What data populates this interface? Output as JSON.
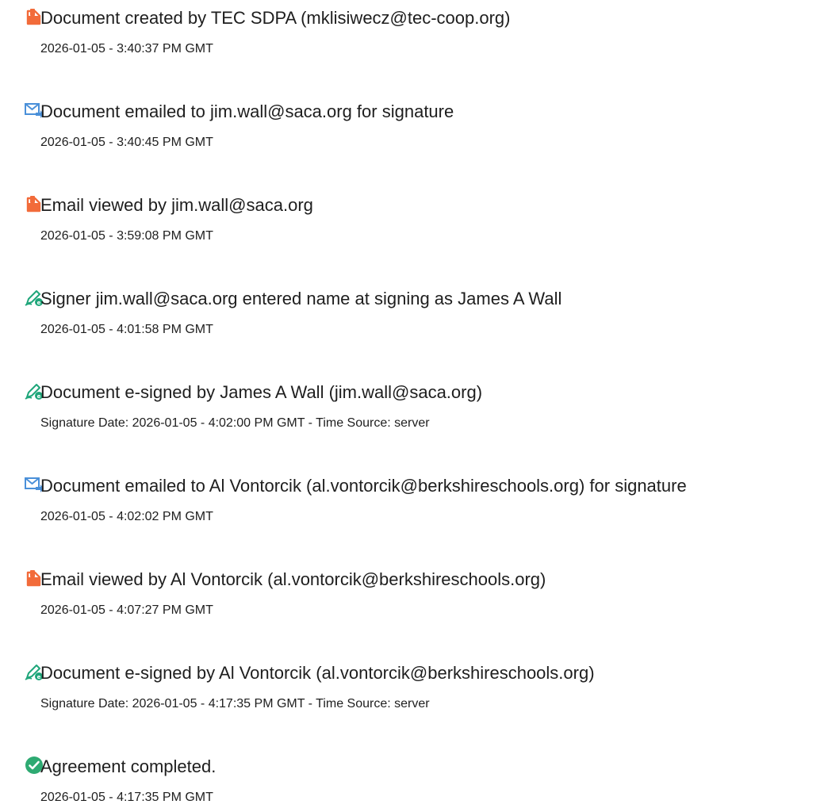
{
  "events": [
    {
      "icon": "document-created-icon",
      "title": "Document created by TEC SDPA (mklisiwecz@tec-coop.org)",
      "time": "2026-01-05 - 3:40:37 PM GMT"
    },
    {
      "icon": "email-sent-icon",
      "title": "Document emailed to jim.wall@saca.org for signature",
      "time": "2026-01-05 - 3:40:45 PM GMT"
    },
    {
      "icon": "document-viewed-icon",
      "title": "Email viewed by jim.wall@saca.org",
      "time": "2026-01-05 - 3:59:08 PM GMT"
    },
    {
      "icon": "signature-pen-icon",
      "title": "Signer jim.wall@saca.org entered name at signing as James A Wall",
      "time": "2026-01-05 - 4:01:58 PM GMT"
    },
    {
      "icon": "signature-pen-icon",
      "title": "Document e-signed by James A Wall (jim.wall@saca.org)",
      "time": "Signature Date: 2026-01-05 - 4:02:00 PM GMT - Time Source: server"
    },
    {
      "icon": "email-sent-icon",
      "title": "Document emailed to Al Vontorcik (al.vontorcik@berkshireschools.org) for signature",
      "time": "2026-01-05 - 4:02:02 PM GMT"
    },
    {
      "icon": "document-viewed-icon",
      "title": "Email viewed by Al Vontorcik (al.vontorcik@berkshireschools.org)",
      "time": "2026-01-05 - 4:07:27 PM GMT"
    },
    {
      "icon": "signature-pen-icon",
      "title": "Document e-signed by Al Vontorcik (al.vontorcik@berkshireschools.org)",
      "time": "Signature Date: 2026-01-05 - 4:17:35 PM GMT - Time Source: server"
    },
    {
      "icon": "completed-check-icon",
      "title": "Agreement completed.",
      "time": "2026-01-05 - 4:17:35 PM GMT"
    }
  ],
  "colors": {
    "document_orange": "#f26b3a",
    "email_blue": "#4a90d9",
    "pen_green": "#1fa67a",
    "check_green": "#2eaa72"
  }
}
